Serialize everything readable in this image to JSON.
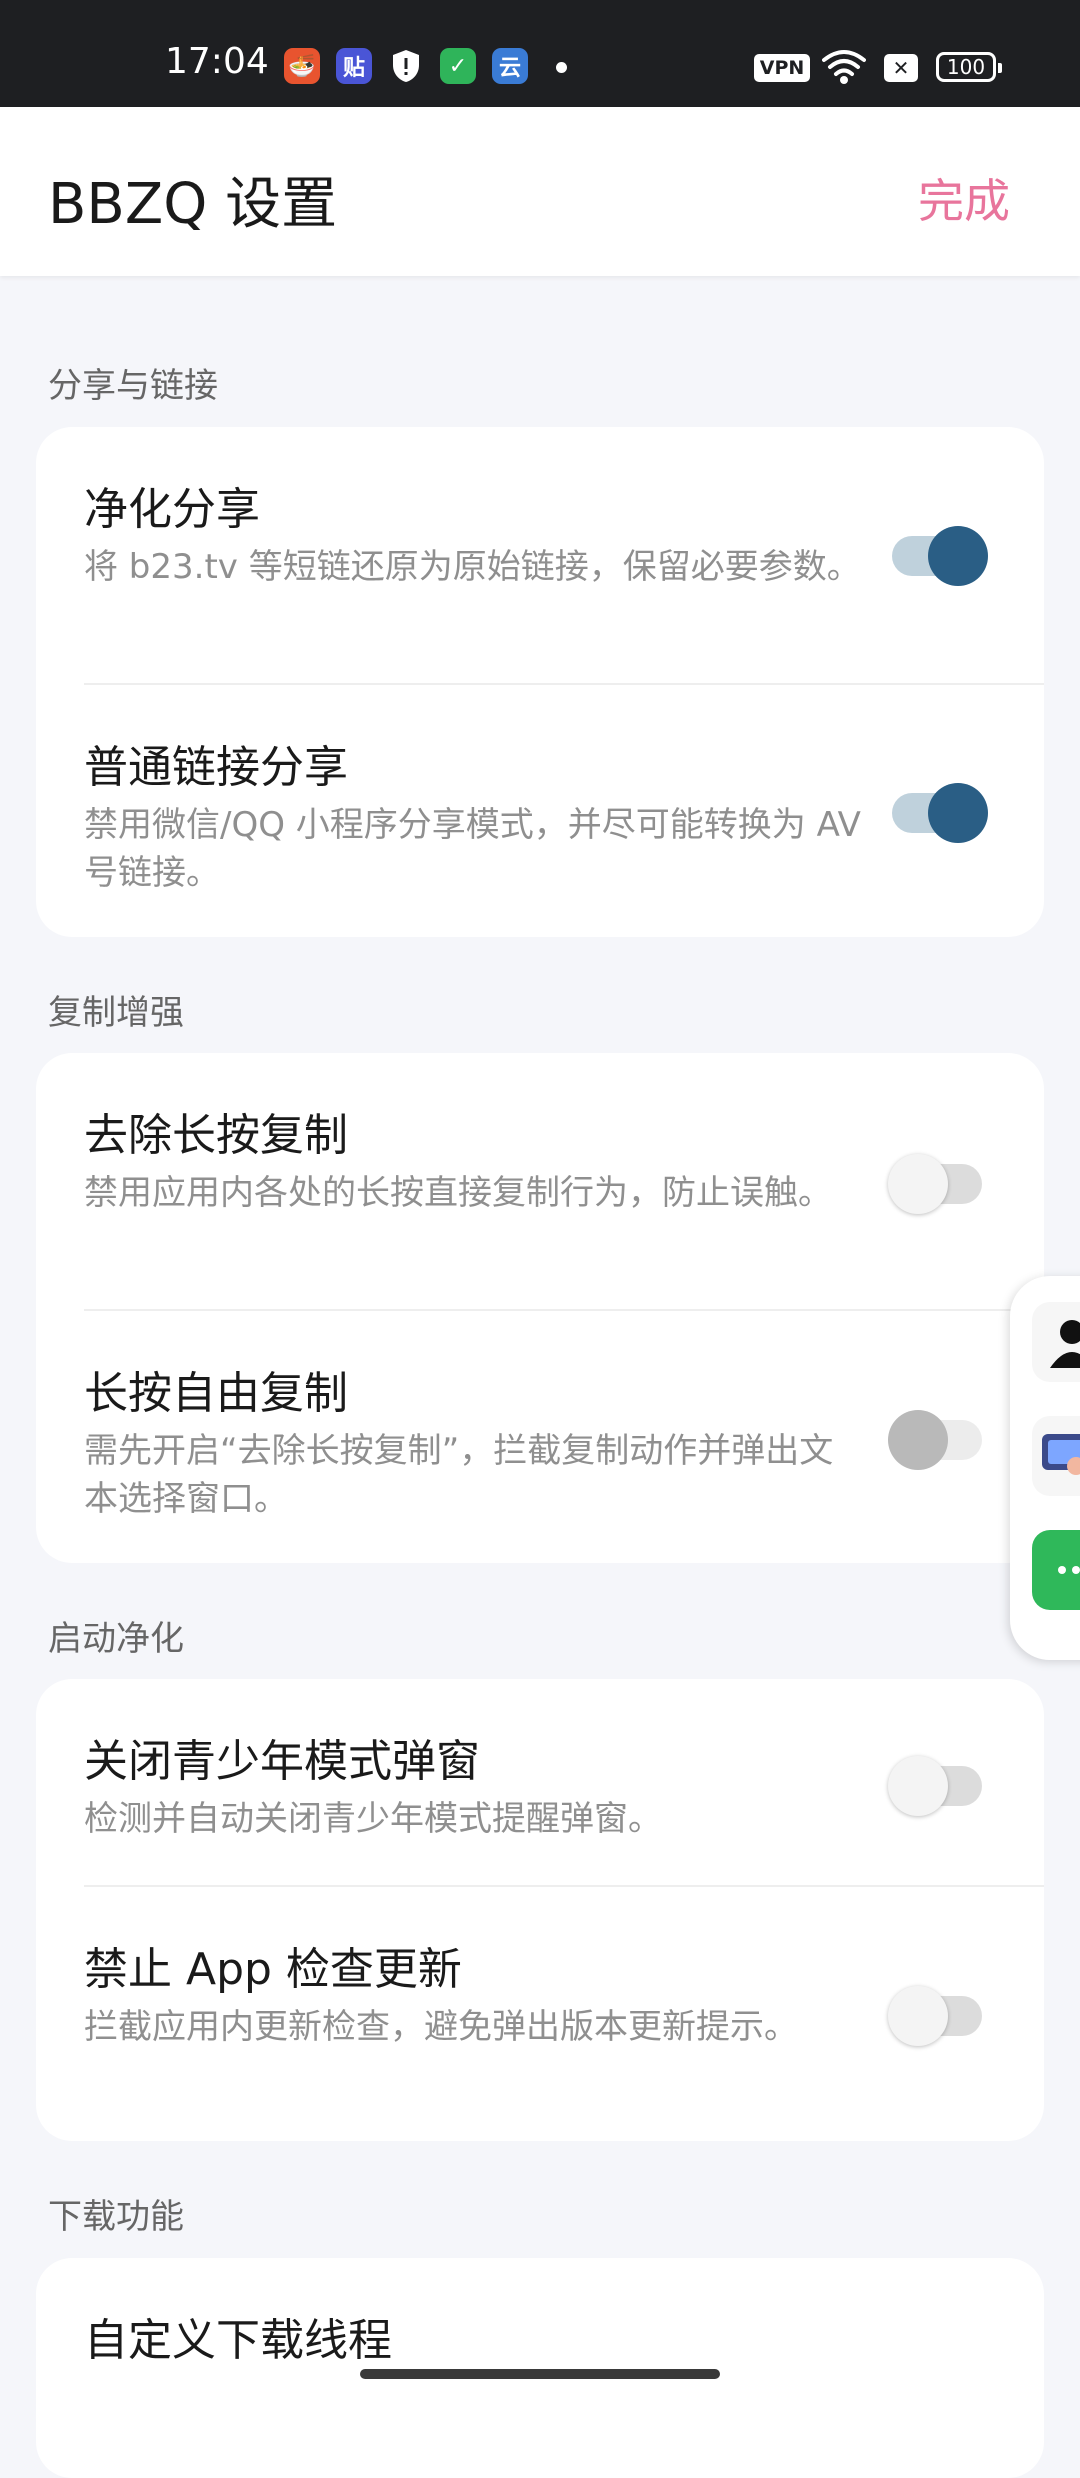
{
  "status_bar": {
    "time": "17:04",
    "notification_icons": [
      "food-app-icon",
      "tieba-app-icon",
      "shield-icon",
      "security-app-icon",
      "cloud-app-icon"
    ],
    "vpn": "VPN",
    "battery": "100"
  },
  "header": {
    "title": "BBZQ 设置",
    "done_label": "完成"
  },
  "sections": [
    {
      "title": "分享与链接",
      "items": [
        {
          "title": "净化分享",
          "desc": "将 b23.tv 等短链还原为原始链接，保留必要参数。",
          "enabled": true
        },
        {
          "title": "普通链接分享",
          "desc": "禁用微信/QQ 小程序分享模式，并尽可能转换为 AV 号链接。",
          "enabled": true
        }
      ]
    },
    {
      "title": "复制增强",
      "items": [
        {
          "title": "去除长按复制",
          "desc": "禁用应用内各处的长按直接复制行为，防止误触。",
          "enabled": false
        },
        {
          "title": "长按自由复制",
          "desc": "需先开启“去除长按复制”，拦截复制动作并弹出文本选择窗口。",
          "enabled": false,
          "disabled": true
        }
      ]
    },
    {
      "title": "启动净化",
      "items": [
        {
          "title": "关闭青少年模式弹窗",
          "desc": "检测并自动关闭青少年模式提醒弹窗。",
          "enabled": false
        },
        {
          "title": "禁止 App 检查更新",
          "desc": "拦截应用内更新检查，避免弹出版本更新提示。",
          "enabled": false
        }
      ]
    },
    {
      "title": "下载功能",
      "items": [
        {
          "title": "自定义下载线程"
        }
      ]
    }
  ],
  "colors": {
    "accent": "#e8759c",
    "switch_on": "#2a5e85",
    "switch_on_track": "#bfd1dc",
    "background": "#f5f6fa"
  }
}
